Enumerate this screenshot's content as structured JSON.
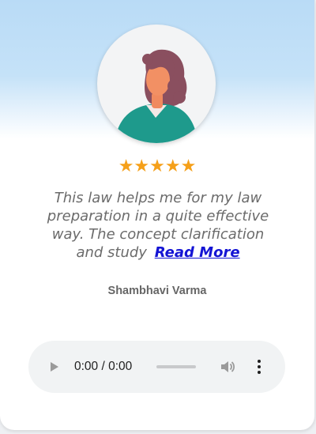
{
  "testimonial": {
    "stars": "★★★★★",
    "rating_value": 5,
    "rating_max": 5,
    "star_color": "#f5a01a",
    "quote": "This law helps me for my law preparation in a quite effective way. The concept clarification and study",
    "read_more_label": "Read More",
    "author": "Shambhavi Varma",
    "avatar_icon": "woman-avatar-icon"
  },
  "audio": {
    "time": "0:00 / 0:00",
    "progress": 0,
    "play_icon": "play-icon",
    "volume_icon": "volume-icon",
    "menu_icon": "more-vertical-icon"
  }
}
